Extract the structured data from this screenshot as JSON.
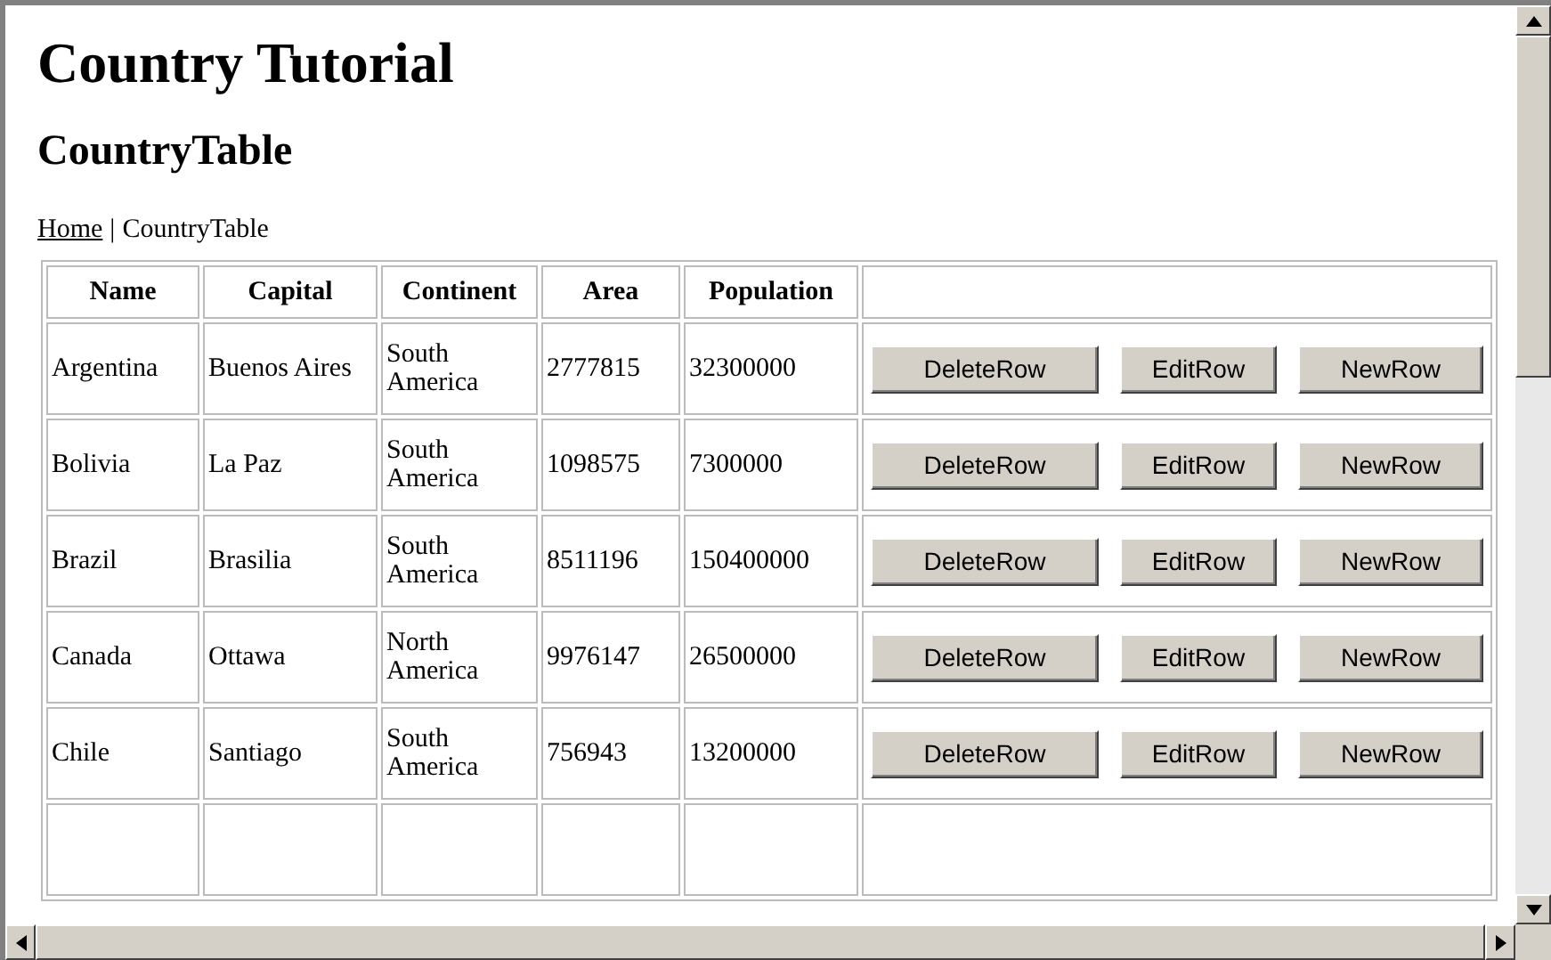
{
  "heading": "Country Tutorial",
  "subheading": "CountryTable",
  "breadcrumb": {
    "link": "Home",
    "separator": "|",
    "current": "CountryTable"
  },
  "table": {
    "columns": [
      "Name",
      "Capital",
      "Continent",
      "Area",
      "Population"
    ],
    "rows": [
      {
        "name": "Argentina",
        "capital": "Buenos Aires",
        "continent": "South America",
        "area": "2777815",
        "population": "32300000",
        "actions": [
          "DeleteRow",
          "EditRow",
          "NewRow"
        ]
      },
      {
        "name": "Bolivia",
        "capital": "La Paz",
        "continent": "South America",
        "area": "1098575",
        "population": "7300000",
        "actions": [
          "DeleteRow",
          "EditRow",
          "NewRow"
        ]
      },
      {
        "name": "Brazil",
        "capital": "Brasilia",
        "continent": "South America",
        "area": "8511196",
        "population": "150400000",
        "actions": [
          "DeleteRow",
          "EditRow",
          "NewRow"
        ]
      },
      {
        "name": "Canada",
        "capital": "Ottawa",
        "continent": "North America",
        "area": "9976147",
        "population": "26500000",
        "actions": [
          "DeleteRow",
          "EditRow",
          "NewRow"
        ]
      },
      {
        "name": "Chile",
        "capital": "Santiago",
        "continent": "South America",
        "area": "756943",
        "population": "13200000",
        "actions": [
          "DeleteRow",
          "EditRow",
          "NewRow"
        ]
      }
    ]
  }
}
